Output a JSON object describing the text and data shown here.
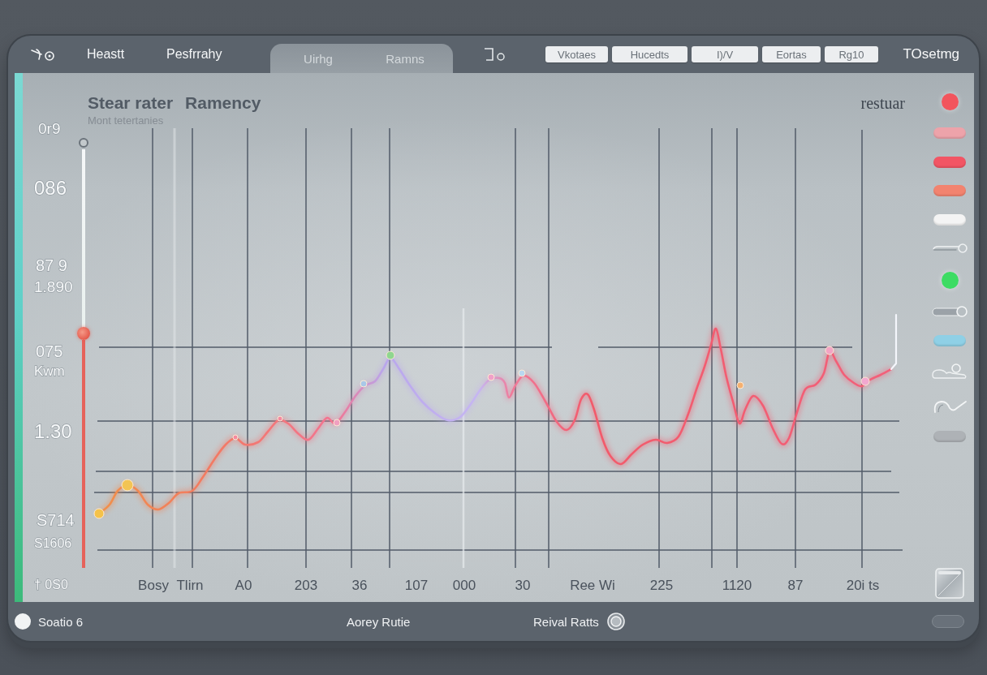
{
  "top_bar": {
    "nav_items": [
      "Heastt",
      "Pesfrrahy"
    ],
    "segment_labels": [
      "Uirhg",
      "Ramns"
    ],
    "buttons": [
      "Vkotaes",
      "Hucedts",
      "I)/V",
      "Eortas",
      "Rg10"
    ],
    "right_label": "TOsetmg"
  },
  "panel": {
    "title_parts": [
      "Stear rater",
      "Ramency"
    ],
    "subtitle": "Mont tetertanies",
    "corner_label": "restuar",
    "y_labels": [
      "0r9",
      "086",
      "87 9",
      "1.890",
      "075",
      "Kwm",
      "1.30",
      "S714",
      "S1606",
      "† 0S0"
    ],
    "slider": {
      "level": 0.56
    },
    "x_labels": [
      "Bosy",
      "Tlirn",
      "A0",
      "203",
      "36",
      "107",
      "000",
      "30",
      "Ree Wi",
      "225",
      "1120",
      "87",
      "20i ts"
    ],
    "side_items": [
      {
        "kind": "dot",
        "color": "#f2555d"
      },
      {
        "kind": "pill",
        "color": "#eda3aa"
      },
      {
        "kind": "pill",
        "color": "#f25564"
      },
      {
        "kind": "pill",
        "color": "#f2836f"
      },
      {
        "kind": "pill",
        "color": "#f4f4f4"
      },
      {
        "kind": "switch"
      },
      {
        "kind": "dot",
        "color": "#3ddc63"
      },
      {
        "kind": "slider"
      },
      {
        "kind": "pill",
        "color": "#8fd0e6"
      },
      {
        "kind": "cloud"
      },
      {
        "kind": "wave"
      },
      {
        "kind": "pill",
        "color": "#aeb2b6"
      }
    ]
  },
  "bottom_bar": {
    "left_label": "Soatio 6",
    "center_label": "Aorey Rutie",
    "right_label": "Reival Ratts"
  }
}
